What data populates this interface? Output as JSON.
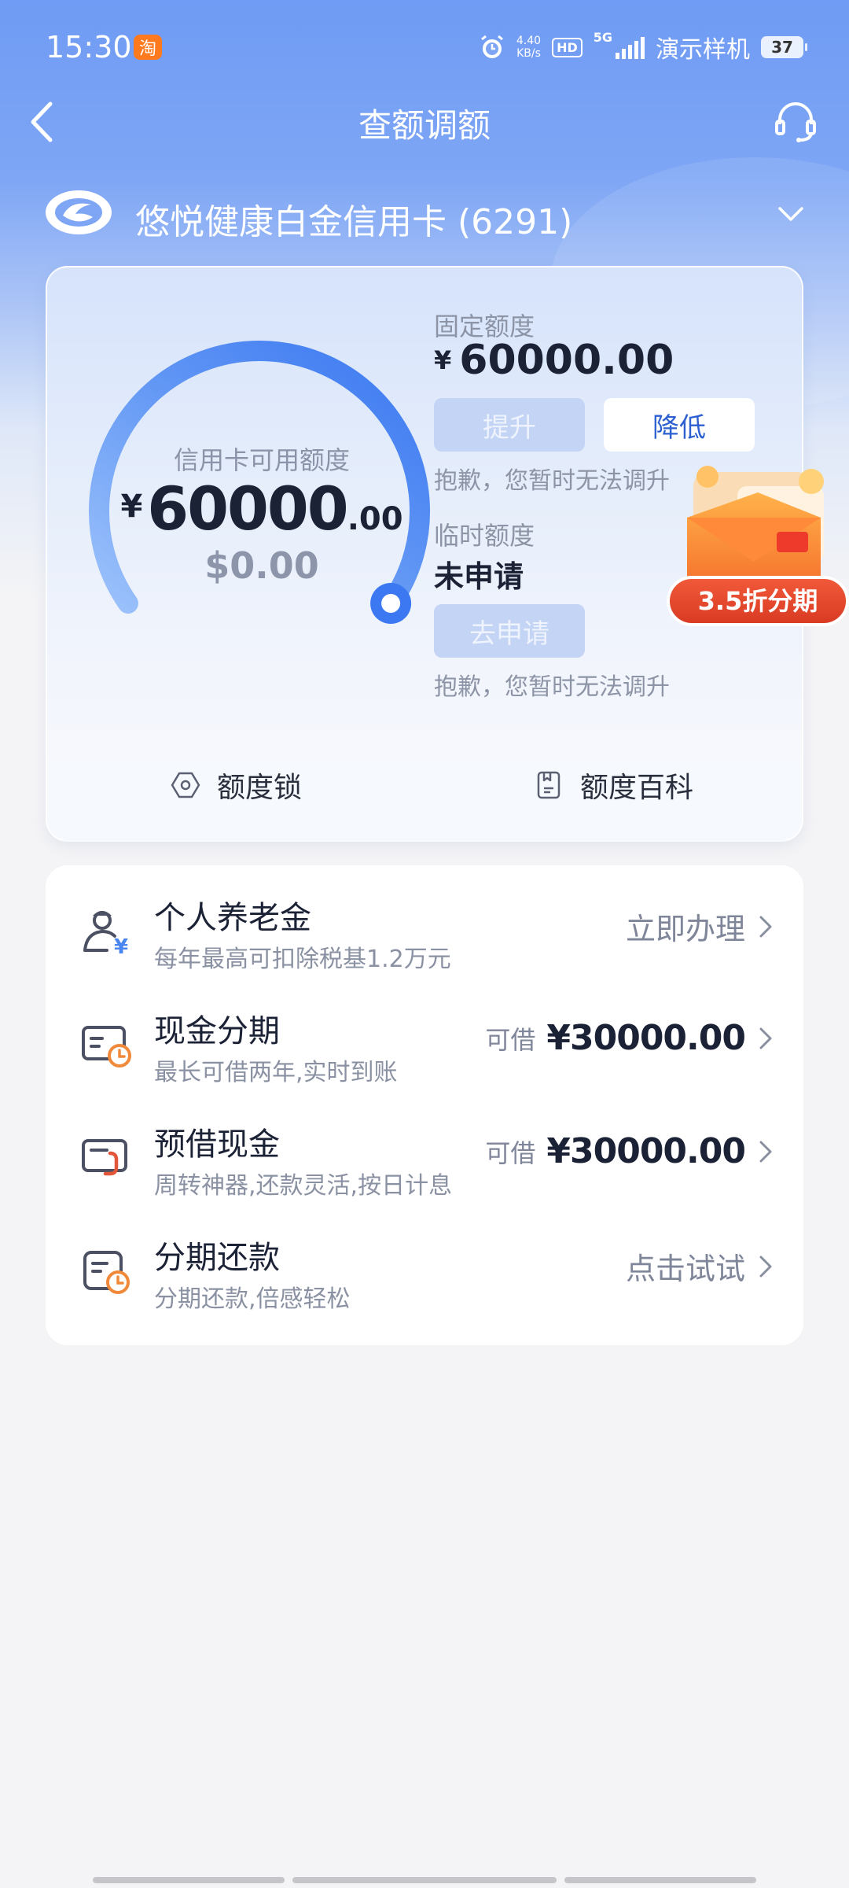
{
  "status_bar": {
    "time": "15:30",
    "app_badge": "淘",
    "net_speed_value": "4.40",
    "net_speed_unit": "KB/s",
    "hd": "HD",
    "net_type": "5G",
    "carrier": "演示样机",
    "battery": "37"
  },
  "nav": {
    "title": "查额调额"
  },
  "card": {
    "name": "悠悦健康白金信用卡 (6291)"
  },
  "gauge": {
    "label": "信用卡可用额度",
    "currency": "¥",
    "amount_int": "60000",
    "amount_dec": ".00",
    "usd": "$0.00",
    "available_fraction": 1.0
  },
  "fixed_limit": {
    "label": "固定额度",
    "currency": "¥",
    "amount": "60000.00",
    "raise_button": "提升",
    "lower_button": "降低",
    "note": "抱歉，您暂时无法调升"
  },
  "temp_limit": {
    "label": "临时额度",
    "status": "未申请",
    "apply_button": "去申请",
    "note": "抱歉，您暂时无法调升"
  },
  "footer": {
    "lock_label": "额度锁",
    "wiki_label": "额度百科"
  },
  "promo": {
    "text": "3.5折分期"
  },
  "services": [
    {
      "title": "个人养老金",
      "subtitle": "每年最高可扣除税基1.2万元",
      "prefix": "",
      "amount": "",
      "action": "立即办理",
      "icon": "pension-icon"
    },
    {
      "title": "现金分期",
      "subtitle": "最长可借两年,实时到账",
      "prefix": "可借",
      "amount": "¥30000.00",
      "action": "",
      "icon": "cash-installment-icon"
    },
    {
      "title": "预借现金",
      "subtitle": "周转神器,还款灵活,按日计息",
      "prefix": "可借",
      "amount": "¥30000.00",
      "action": "",
      "icon": "cash-advance-icon"
    },
    {
      "title": "分期还款",
      "subtitle": "分期还款,倍感轻松",
      "prefix": "",
      "amount": "",
      "action": "点击试试",
      "icon": "installment-repay-icon"
    }
  ],
  "colors": {
    "header_blue": "#6f9bf4",
    "gauge_blue": "#3b78f2",
    "button_blue_text": "#2c5fd0",
    "promo_red": "#e84a2e"
  }
}
